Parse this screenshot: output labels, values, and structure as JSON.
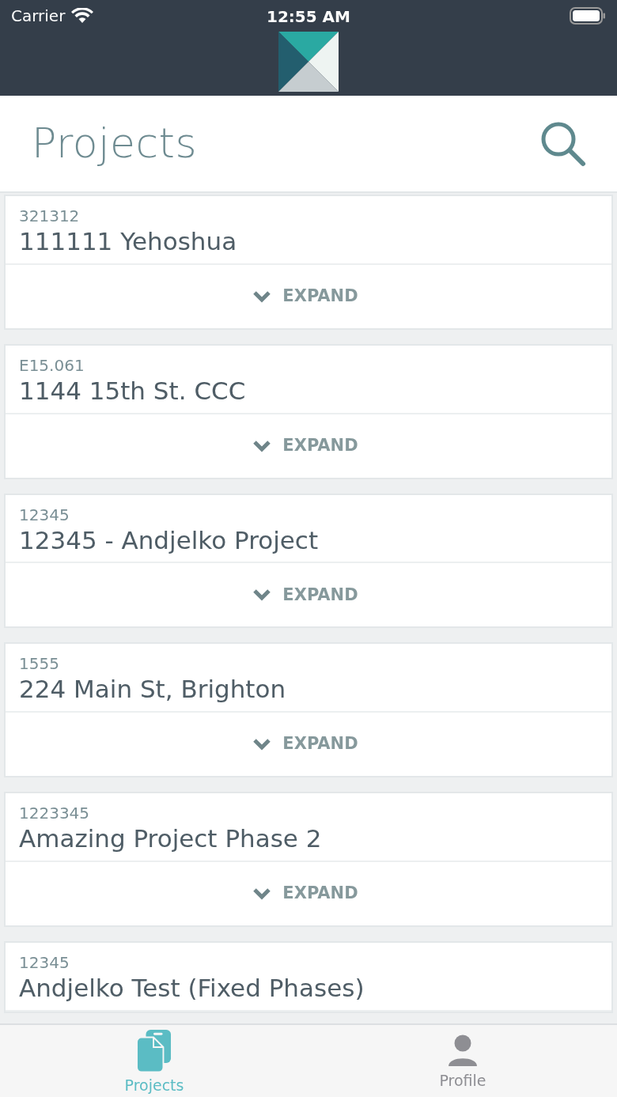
{
  "status_bar": {
    "carrier": "Carrier",
    "time": "12:55 AM"
  },
  "header": {
    "title": "Projects"
  },
  "projects": [
    {
      "number": "321312",
      "name": "111111 Yehoshua",
      "action": "EXPAND"
    },
    {
      "number": "E15.061",
      "name": "1144 15th St. CCC",
      "action": "EXPAND"
    },
    {
      "number": "12345",
      "name": "12345 - Andjelko Project",
      "action": "EXPAND"
    },
    {
      "number": "1555",
      "name": "224 Main St, Brighton",
      "action": "EXPAND"
    },
    {
      "number": "1223345",
      "name": "Amazing Project Phase 2",
      "action": "EXPAND"
    },
    {
      "number": "12345",
      "name": "Andjelko Test (Fixed Phases)"
    }
  ],
  "tabs": [
    {
      "label": "Projects",
      "kind": "projects",
      "selected": true
    },
    {
      "label": "Profile",
      "kind": "profile",
      "selected": false
    }
  ]
}
